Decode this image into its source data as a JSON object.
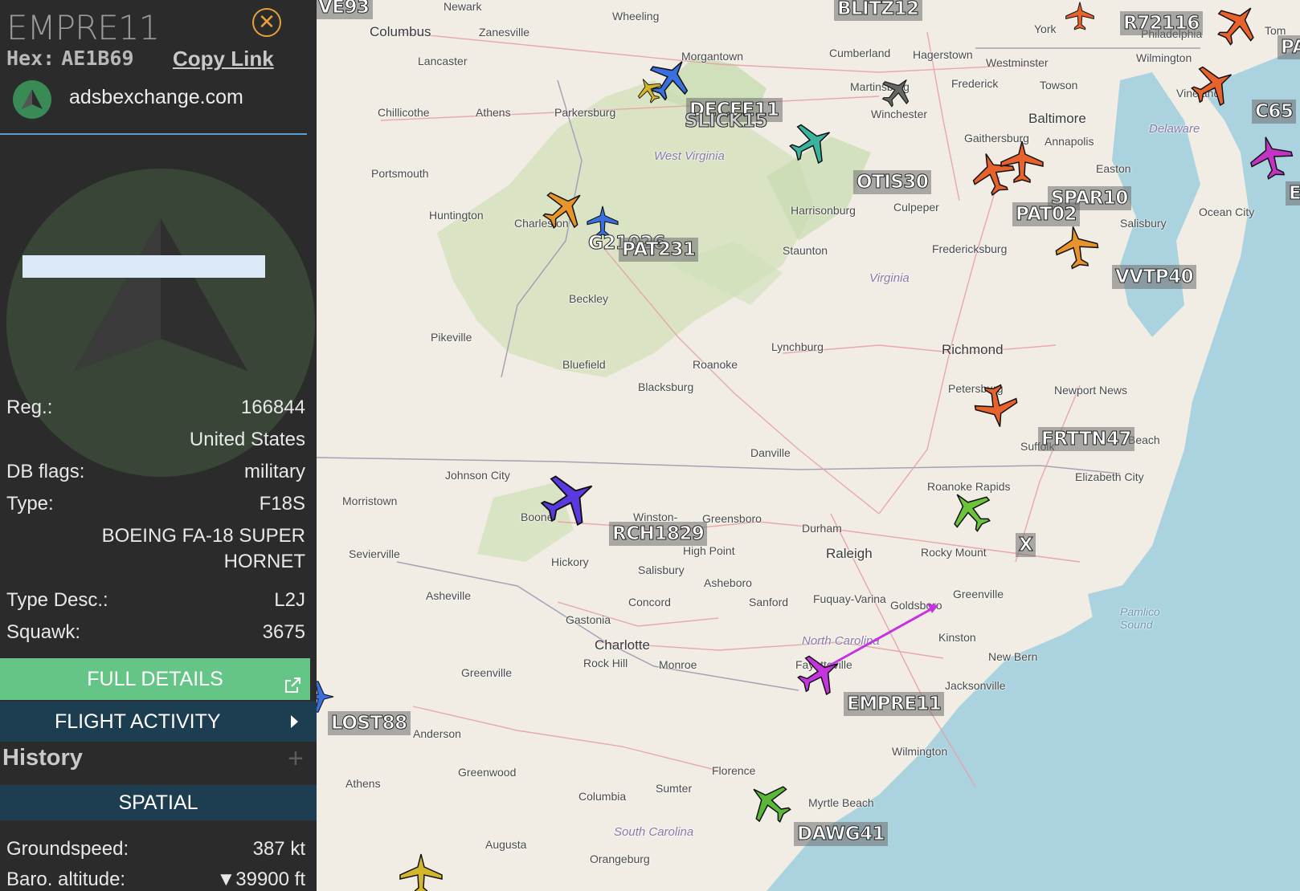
{
  "sidebar": {
    "callsign": "EMPRE11",
    "hex_label": "Hex:",
    "hex_value": "AE1B69",
    "copy_link": "Copy Link",
    "site": "adsbexchange.com",
    "reg_label": "Reg.:",
    "reg_value": "166844",
    "country": "United States",
    "dbflags_label": "DB flags:",
    "dbflags_value": "military",
    "type_label": "Type:",
    "type_value": "F18S",
    "type_name_1": "BOEING FA-18 SUPER",
    "type_name_2": "HORNET",
    "typedesc_label": "Type Desc.:",
    "typedesc_value": "L2J",
    "squawk_label": "Squawk:",
    "squawk_value": "3675",
    "full_details": "FULL DETAILS",
    "flight_activity": "FLIGHT ACTIVITY",
    "history": "History",
    "spatial": "SPATIAL",
    "groundspeed_label": "Groundspeed:",
    "groundspeed_value": "387 kt",
    "baro_label": "Baro. altitude:",
    "baro_value": "▼39900 ft",
    "colors": {
      "accent_green": "#64c586",
      "panel_blue": "#1d3d50",
      "close_orange": "#e8a13a"
    }
  },
  "map": {
    "cities": [
      {
        "name": "Wheeling"
      },
      {
        "name": "Newark"
      },
      {
        "name": "Columbus"
      },
      {
        "name": "Zanesville"
      },
      {
        "name": "Morgantown"
      },
      {
        "name": "Cumberland"
      },
      {
        "name": "Hagerstown"
      },
      {
        "name": "Westminster"
      },
      {
        "name": "York"
      },
      {
        "name": "Wilmington"
      },
      {
        "name": "Lancaster"
      },
      {
        "name": "Chillicothe"
      },
      {
        "name": "Athens"
      },
      {
        "name": "Parkersburg"
      },
      {
        "name": "Martinsburg"
      },
      {
        "name": "Frederick"
      },
      {
        "name": "Towson"
      },
      {
        "name": "Baltimore"
      },
      {
        "name": "Winchester"
      },
      {
        "name": "Gaithersburg"
      },
      {
        "name": "Annapolis"
      },
      {
        "name": "Easton"
      },
      {
        "name": "Portsmouth"
      },
      {
        "name": "Huntington"
      },
      {
        "name": "Charleston"
      },
      {
        "name": "Harrisonburg"
      },
      {
        "name": "Culpeper"
      },
      {
        "name": "Staunton"
      },
      {
        "name": "Fredericksburg"
      },
      {
        "name": "Salisbury"
      },
      {
        "name": "Ocean City"
      },
      {
        "name": "Beckley"
      },
      {
        "name": "Pikeville"
      },
      {
        "name": "Bluefield"
      },
      {
        "name": "Roanoke"
      },
      {
        "name": "Lynchburg"
      },
      {
        "name": "Richmond"
      },
      {
        "name": "Blacksburg"
      },
      {
        "name": "Petersburg"
      },
      {
        "name": "Newport News"
      },
      {
        "name": "Beach"
      },
      {
        "name": "Danville"
      },
      {
        "name": "Johnson City"
      },
      {
        "name": "Morristown"
      },
      {
        "name": "Elizabeth City"
      },
      {
        "name": "Roanoke Rapids"
      },
      {
        "name": "Boone"
      },
      {
        "name": "Winston-"
      },
      {
        "name": "Greensboro"
      },
      {
        "name": "Durham"
      },
      {
        "name": "High Point"
      },
      {
        "name": "Raleigh"
      },
      {
        "name": "Rocky Mount"
      },
      {
        "name": "Sevierville"
      },
      {
        "name": "Hickory"
      },
      {
        "name": "Salisbury"
      },
      {
        "name": "Asheboro"
      },
      {
        "name": "Asheville"
      },
      {
        "name": "Concord"
      },
      {
        "name": "Sanford"
      },
      {
        "name": "Fuquay-Varina"
      },
      {
        "name": "Goldsboro"
      },
      {
        "name": "Greenville"
      },
      {
        "name": "Gastonia"
      },
      {
        "name": "Charlotte"
      },
      {
        "name": "Kinston"
      },
      {
        "name": "Rock Hill"
      },
      {
        "name": "Monroe"
      },
      {
        "name": "Fayetteville"
      },
      {
        "name": "New Bern"
      },
      {
        "name": "Greenville"
      },
      {
        "name": "Jacksonville"
      },
      {
        "name": "Anderson"
      },
      {
        "name": "Wilmington"
      },
      {
        "name": "Athens"
      },
      {
        "name": "Greenwood"
      },
      {
        "name": "Florence"
      },
      {
        "name": "Columbia"
      },
      {
        "name": "Sumter"
      },
      {
        "name": "Myrtle Beach"
      },
      {
        "name": "Augusta"
      },
      {
        "name": "Orangeburg"
      },
      {
        "name": "Philadelphia"
      },
      {
        "name": "Vineland"
      },
      {
        "name": "Tom"
      },
      {
        "name": "Suffolk"
      }
    ],
    "states": [
      "West Virginia",
      "Virginia",
      "North Carolina",
      "South Carolina",
      "Delaware",
      "Pamlico Sound"
    ],
    "aircraft": [
      {
        "callsign": "VE93",
        "color": "#e8632b"
      },
      {
        "callsign": "BLITZ12",
        "color": "#e8632b"
      },
      {
        "callsign": "R72116",
        "color": "#e8632b"
      },
      {
        "callsign": "PA",
        "color": "#e8632b"
      },
      {
        "callsign": "DECEE11",
        "color": "#3a6fe0"
      },
      {
        "callsign": "SLICK15",
        "color": "#d4b62a"
      },
      {
        "callsign": "C65",
        "color": "#e8632b"
      },
      {
        "callsign": "OTIS30",
        "color": "#3ab39e"
      },
      {
        "callsign": "SPAR10",
        "color": "#e8632b"
      },
      {
        "callsign": "PAT02",
        "color": "#e8632b"
      },
      {
        "callsign": "E",
        "color": "#c434c4"
      },
      {
        "callsign": "G21026",
        "color": "#3a6fe0"
      },
      {
        "callsign": "PAT231",
        "color": "#e8932b"
      },
      {
        "callsign": "VVTP40",
        "color": "#e8932b"
      },
      {
        "callsign": "FRTTN47",
        "color": "#e8632b"
      },
      {
        "callsign": "X",
        "color": "#6cc43a"
      },
      {
        "callsign": "RCH1829",
        "color": "#5a3ae0"
      },
      {
        "callsign": "EMPRE11",
        "color": "#c434e0"
      },
      {
        "callsign": "LOST88",
        "color": "#3a6fe0"
      },
      {
        "callsign": "DAWG41",
        "color": "#5ab838"
      }
    ]
  }
}
